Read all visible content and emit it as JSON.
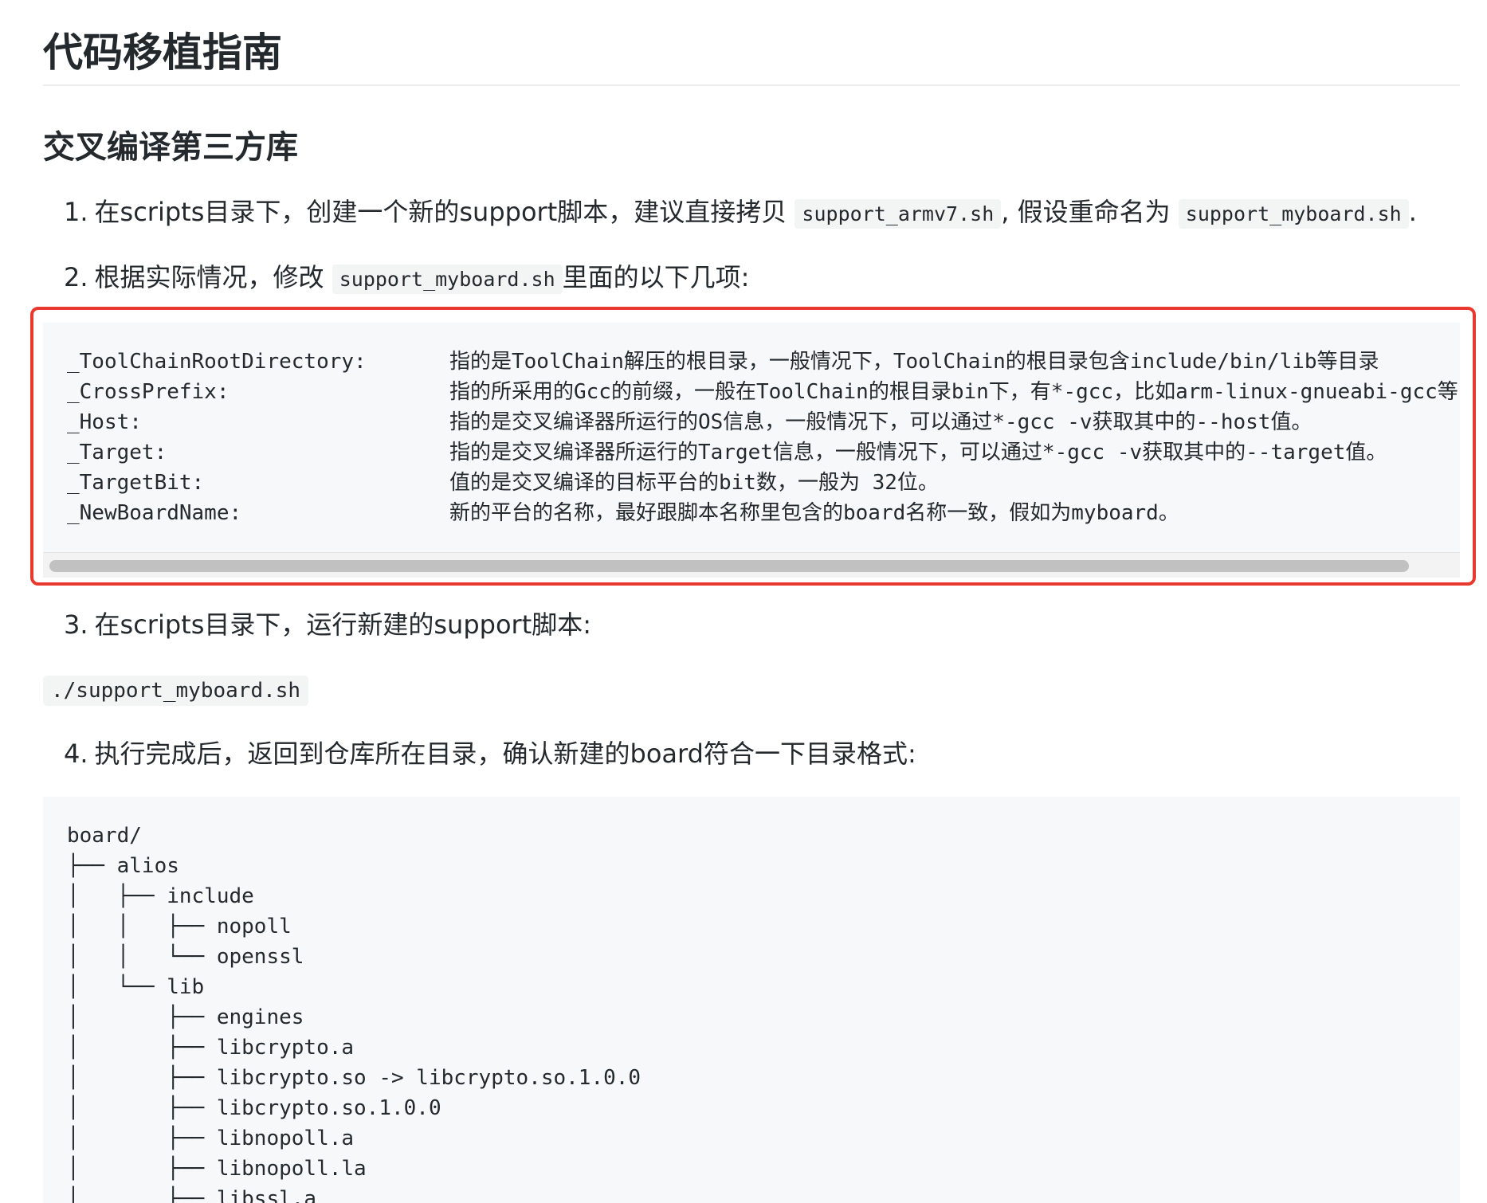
{
  "title": "代码移植指南",
  "section_title": "交叉编译第三方库",
  "steps": [
    {
      "number": "1.",
      "text_before": "在scripts目录下，创建一个新的support脚本，建议直接拷贝",
      "code1": "support_armv7.sh",
      "text_middle": ", 假设重命名为",
      "code2": "support_myboard.sh",
      "text_after": "."
    },
    {
      "number": "2.",
      "text_before": "根据实际情况，修改",
      "code1": "support_myboard.sh",
      "text_after": "里面的以下几项:"
    },
    {
      "number": "3.",
      "text": "在scripts目录下，运行新建的support脚本:"
    },
    {
      "number": "4.",
      "text": "执行完成后，返回到仓库所在目录，确认新建的board符合一下目录格式:"
    }
  ],
  "config_items": [
    {
      "key": "_ToolChainRootDirectory:",
      "description": "指的是ToolChain解压的根目录，一般情况下，ToolChain的根目录包含include/bin/lib等目录"
    },
    {
      "key": "_CrossPrefix:",
      "description": "指的所采用的Gcc的前缀，一般在ToolChain的根目录bin下，有*-gcc，比如arm-linux-gnueabi-gcc等"
    },
    {
      "key": "_Host:",
      "description": "指的是交叉编译器所运行的OS信息，一般情况下，可以通过*-gcc -v获取其中的--host值。"
    },
    {
      "key": "_Target:",
      "description": "指的是交叉编译器所运行的Target信息，一般情况下，可以通过*-gcc -v获取其中的--target值。"
    },
    {
      "key": "_TargetBit:",
      "description": "值的是交叉编译的目标平台的bit数，一般为 32位。"
    },
    {
      "key": "_NewBoardName:",
      "description": "新的平台的名称，最好跟脚本名称里包含的board名称一致，假如为myboard。"
    }
  ],
  "command": "./support_myboard.sh",
  "tree_lines": [
    "board/",
    "├── alios",
    "│   ├── include",
    "│   │   ├── nopoll",
    "│   │   └── openssl",
    "│   └── lib",
    "│       ├── engines",
    "│       ├── libcrypto.a",
    "│       ├── libcrypto.so -> libcrypto.so.1.0.0",
    "│       ├── libcrypto.so.1.0.0",
    "│       ├── libnopoll.a",
    "│       ├── libnopoll.la",
    "│       ├── libssl.a"
  ],
  "colors": {
    "highlight_border": "#e8392f",
    "code_background": "#f6f8fa",
    "text": "#24292e"
  }
}
